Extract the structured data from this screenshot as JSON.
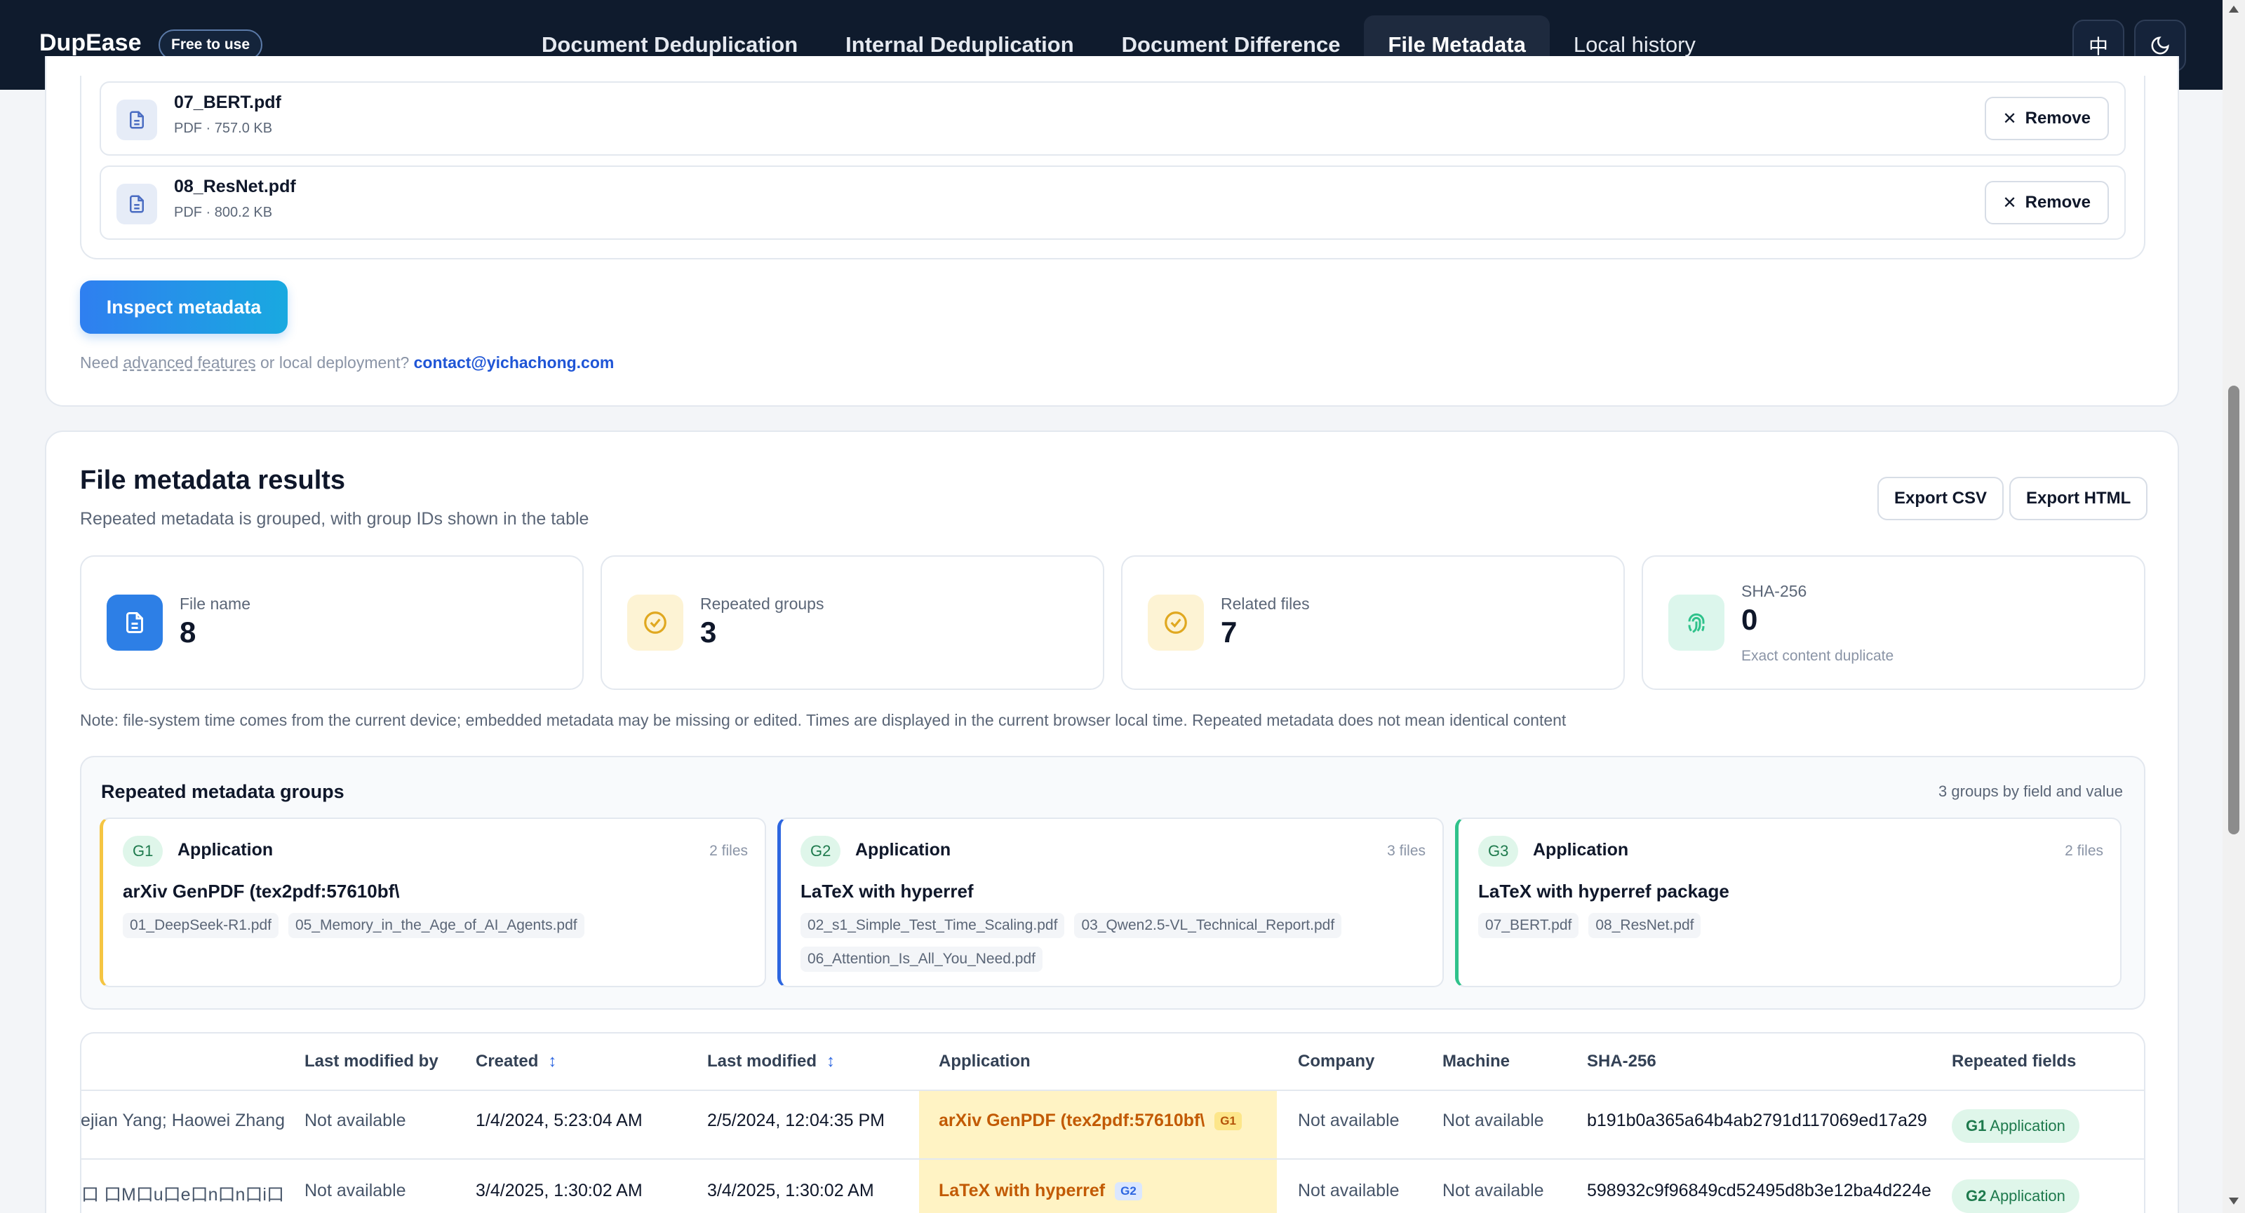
{
  "header": {
    "brand": "DupEase",
    "badge": "Free to use",
    "nav": [
      {
        "label": "Document Deduplication"
      },
      {
        "label": "Internal Deduplication"
      },
      {
        "label": "Document Difference"
      },
      {
        "label": "File Metadata"
      },
      {
        "label": "Local history"
      }
    ],
    "lang_icon": "中",
    "theme_icon": "moon-icon"
  },
  "files": [
    {
      "name": "07_BERT.pdf",
      "meta": "PDF · 757.0 KB",
      "remove": "Remove"
    },
    {
      "name": "08_ResNet.pdf",
      "meta": "PDF · 800.2 KB",
      "remove": "Remove"
    }
  ],
  "inspect_label": "Inspect metadata",
  "contact": {
    "prefix": "Need ",
    "link": "advanced features",
    "middle": " or local deployment? ",
    "email": "contact@yichachong.com"
  },
  "results": {
    "title": "File metadata results",
    "subtitle": "Repeated metadata is grouped, with group IDs shown in the table",
    "export_csv": "Export CSV",
    "export_html": "Export HTML",
    "stats": [
      {
        "label": "File name",
        "value": "8",
        "icon": "file-icon",
        "color": "#2d7fe6"
      },
      {
        "label": "Repeated groups",
        "value": "3",
        "icon": "check-circle-icon",
        "color": "#f5c542"
      },
      {
        "label": "Related files",
        "value": "7",
        "icon": "check-circle-icon",
        "color": "#f5c542"
      },
      {
        "label": "SHA-256",
        "value": "0",
        "note": "Exact content duplicate",
        "icon": "fingerprint-icon",
        "color": "#2fc28b"
      }
    ],
    "note": "Note: file-system time comes from the current device; embedded metadata may be missing or edited. Times are displayed in the current browser local time. Repeated metadata does not mean identical content"
  },
  "groups": {
    "title": "Repeated metadata groups",
    "count": "3 groups by field and value",
    "items": [
      {
        "id": "G1",
        "field": "Application",
        "files": "2 files",
        "value": "arXiv GenPDF (tex2pdf:57610bf\\",
        "chips": [
          "01_DeepSeek-R1.pdf",
          "05_Memory_in_the_Age_of_AI_Agents.pdf"
        ]
      },
      {
        "id": "G2",
        "field": "Application",
        "files": "3 files",
        "value": "LaTeX with hyperref",
        "chips": [
          "02_s1_Simple_Test_Time_Scaling.pdf",
          "03_Qwen2.5-VL_Technical_Report.pdf",
          "06_Attention_Is_All_You_Need.pdf"
        ]
      },
      {
        "id": "G3",
        "field": "Application",
        "files": "2 files",
        "value": "LaTeX with hyperref package",
        "chips": [
          "07_BERT.pdf",
          "08_ResNet.pdf"
        ]
      }
    ]
  },
  "table": {
    "headers": {
      "last_modified_by": "Last modified by",
      "created": "Created",
      "last_modified": "Last modified",
      "application": "Application",
      "company": "Company",
      "machine": "Machine",
      "sha": "SHA-256",
      "repeated": "Repeated fields"
    },
    "rows": [
      {
        "author": "Daya Guo; Dejian Yang; Haowei Zhang",
        "modified_by": "Not available",
        "created": "1/4/2024, 5:23:04 AM",
        "modified": "2/5/2024, 12:04:35 PM",
        "app": "arXiv GenPDF (tex2pdf:57610bf\\",
        "app_group": "G1",
        "company": "Not available",
        "machine": "Not available",
        "sha": "b191b0a365a64b4ab2791d117069ed17a29",
        "rep_id": "G1",
        "rep_field": "Application"
      },
      {
        "author": "口 口M口u口e口n口n口i口g口h口",
        "modified_by": "Not available",
        "created": "3/4/2025, 1:30:02 AM",
        "modified": "3/4/2025, 1:30:02 AM",
        "app": "LaTeX with hyperref",
        "app_group": "G2",
        "company": "Not available",
        "machine": "Not available",
        "sha": "598932c9f96849cd52495d8b3e12ba4d224e",
        "rep_id": "G2",
        "rep_field": "Application"
      }
    ]
  }
}
